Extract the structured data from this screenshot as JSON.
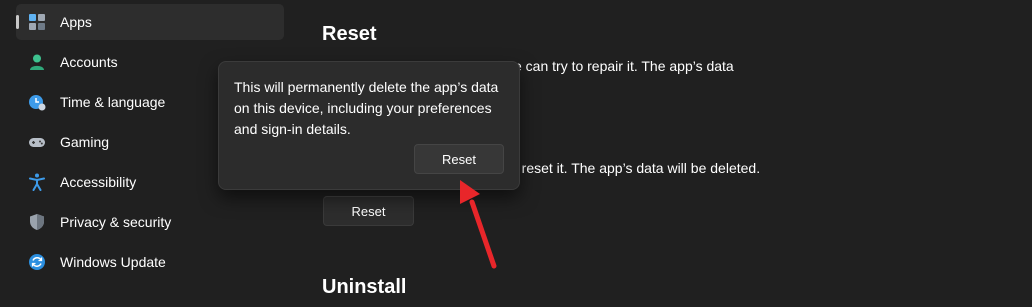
{
  "sidebar": {
    "items": [
      {
        "label": "Apps",
        "icon": "apps-icon",
        "selected": true
      },
      {
        "label": "Accounts",
        "icon": "accounts-icon"
      },
      {
        "label": "Time & language",
        "icon": "time-language-icon"
      },
      {
        "label": "Gaming",
        "icon": "gaming-icon"
      },
      {
        "label": "Accessibility",
        "icon": "accessibility-icon"
      },
      {
        "label": "Privacy & security",
        "icon": "shield-icon"
      },
      {
        "label": "Windows Update",
        "icon": "windows-update-icon"
      }
    ]
  },
  "main": {
    "reset_section": {
      "title": "Reset",
      "repair_text": "e can try to repair it. The app’s data",
      "reset_text": "t, reset it. The app’s data will be deleted.",
      "reset_button": "Reset"
    },
    "uninstall_section": {
      "title": "Uninstall"
    }
  },
  "flyout": {
    "message": "This will permanently delete the app’s data on this device, including your preferences and sign-in details.",
    "confirm_button": "Reset"
  },
  "colors": {
    "background": "#202020",
    "sidebar_selected": "#2d2d2d",
    "annotation_arrow": "#e8262a"
  }
}
